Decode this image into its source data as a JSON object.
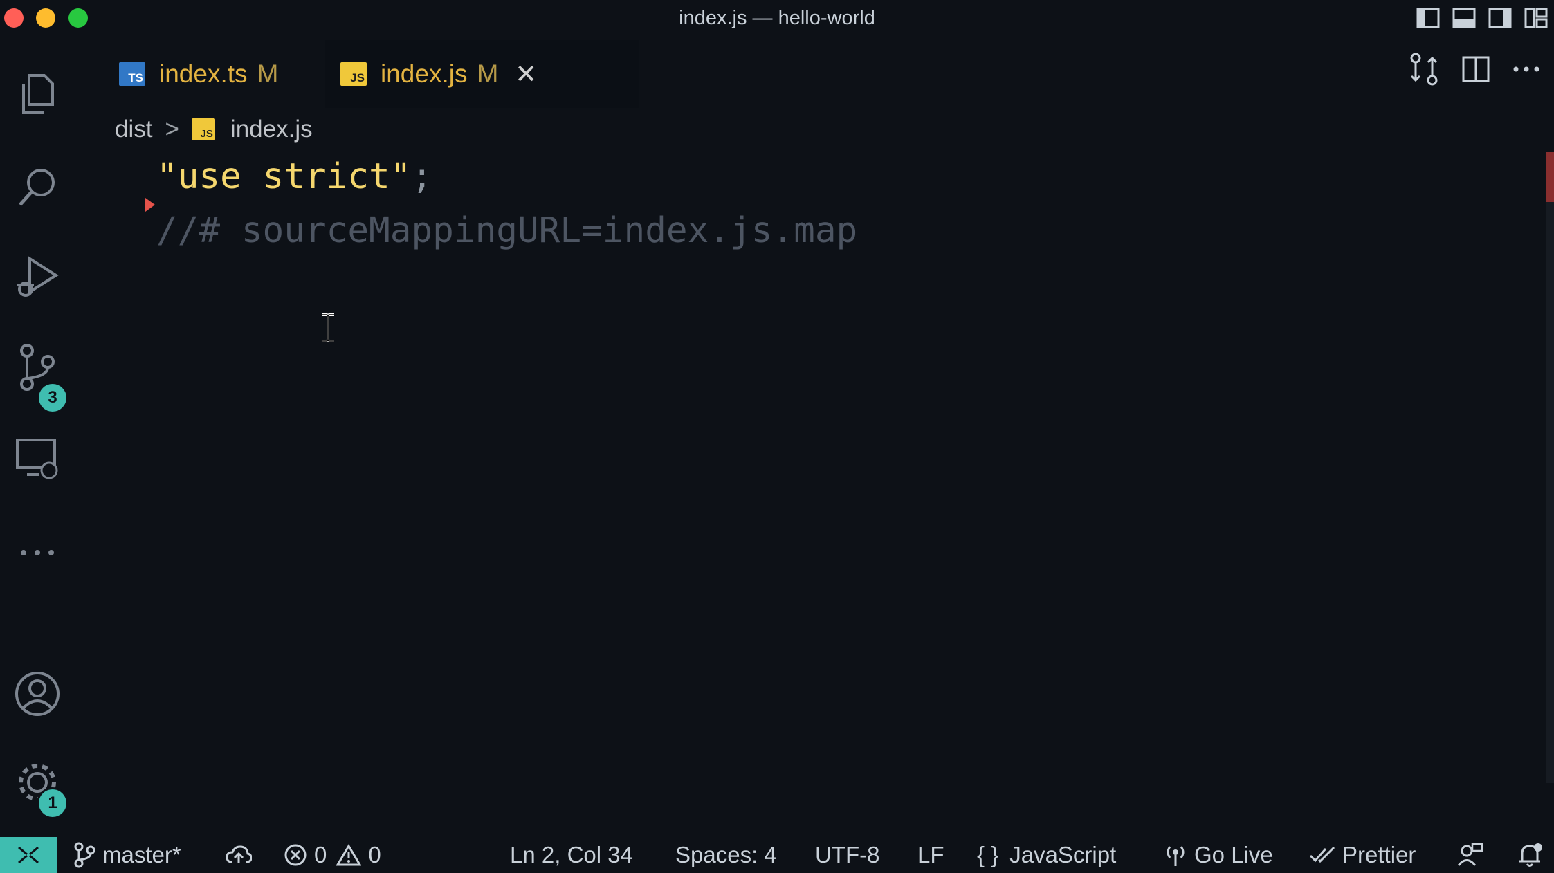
{
  "window": {
    "title": "index.js — hello-world"
  },
  "activity_bar": {
    "source_control_badge": "3",
    "settings_badge": "1"
  },
  "tabs": [
    {
      "file_type": "TS",
      "label": "index.ts",
      "status": "M",
      "active": false
    },
    {
      "file_type": "JS",
      "label": "index.js",
      "status": "M",
      "active": true,
      "close": "✕"
    }
  ],
  "breadcrumb": {
    "folder": "dist",
    "separator": ">",
    "file_type": "JS",
    "file": "index.js"
  },
  "editor": {
    "lines": [
      {
        "string": "\"use strict\"",
        "punct": ";"
      },
      {
        "comment": "//# sourceMappingURL=index.js.map"
      }
    ]
  },
  "status_bar": {
    "branch": "master*",
    "errors": "0",
    "warnings": "0",
    "position": "Ln 2, Col 34",
    "spaces": "Spaces: 4",
    "encoding": "UTF-8",
    "eol": "LF",
    "language": "JavaScript",
    "language_icon": "{ }",
    "go_live": "Go Live",
    "prettier": "Prettier"
  },
  "colors": {
    "background": "#0d1117",
    "accent": "#3fbdb0",
    "tab_text": "#e3b341",
    "string": "#f5d76e",
    "comment": "#4d5562"
  }
}
